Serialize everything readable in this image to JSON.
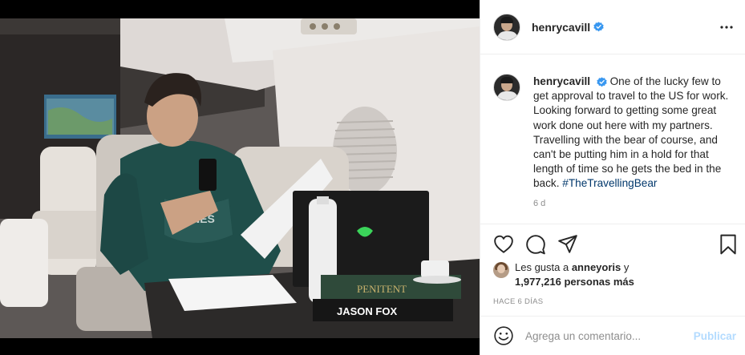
{
  "post": {
    "username": "henrycavill",
    "verified": true,
    "more_icon": "more-dots-icon"
  },
  "caption": {
    "username": "henrycavill",
    "text": " One of the lucky few to get approval to travel to the US for work. Looking forward to getting some great work done out here with my partners. Travelling with the bear of course, and can't be putting him in a hold for that length of time so he gets the bed in the back. ",
    "hashtag": "#TheTravellingBear",
    "time": "6 d"
  },
  "actions": {
    "like_icon": "heart-icon",
    "comment_icon": "comment-bubble-icon",
    "share_icon": "send-icon",
    "save_icon": "bookmark-icon"
  },
  "likes": {
    "prefix": "Les gusta a ",
    "user": "anneyoris",
    "middle": " y",
    "count": "1,977,216 personas más"
  },
  "posted_ago": "HACE 6 DÍAS",
  "comment": {
    "placeholder": "Agrega un comentario...",
    "publish_label": "Publicar",
    "emoji_icon": "smiley-icon"
  },
  "colors": {
    "link": "#00376b",
    "verified_blue": "#3897f0",
    "publish_disabled": "#b3dbff",
    "muted": "#8e8e8e"
  }
}
